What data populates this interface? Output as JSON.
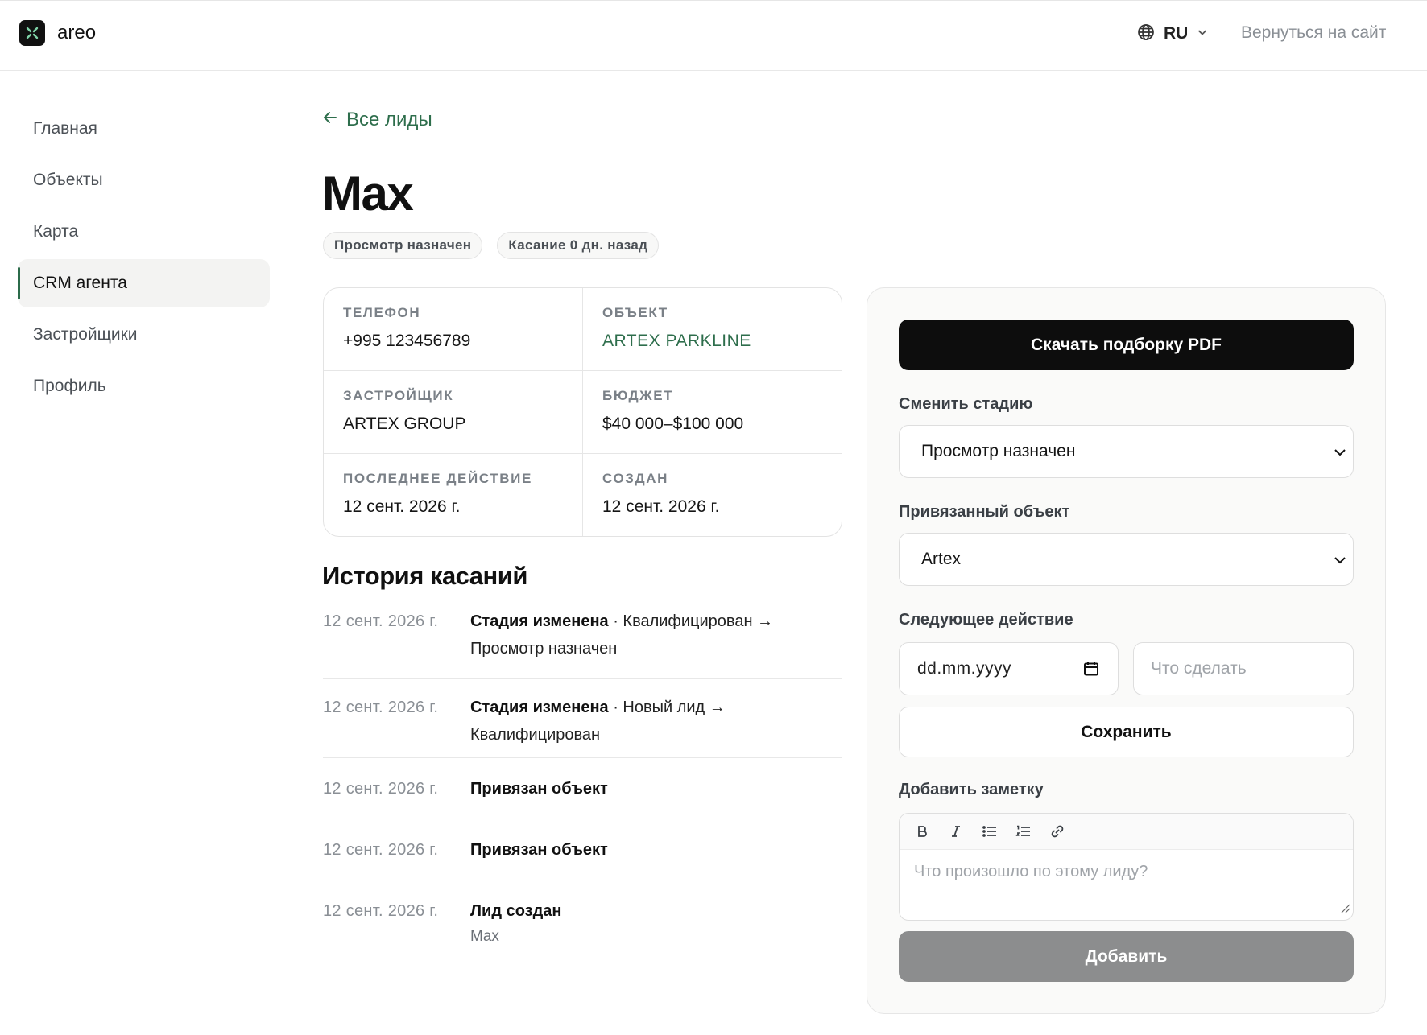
{
  "brand": {
    "name": "areo"
  },
  "header": {
    "language": "RU",
    "back_to_site": "Вернуться на сайт"
  },
  "sidebar": {
    "items": [
      {
        "label": "Главная",
        "active": false
      },
      {
        "label": "Объекты",
        "active": false
      },
      {
        "label": "Карта",
        "active": false
      },
      {
        "label": "CRM агента",
        "active": true
      },
      {
        "label": "Застройщики",
        "active": false
      },
      {
        "label": "Профиль",
        "active": false
      }
    ]
  },
  "main": {
    "back_link": "Все лиды",
    "title": "Max",
    "badges": [
      "Просмотр назначен",
      "Касание 0 дн. назад"
    ],
    "info": {
      "phone_label": "ТЕЛЕФОН",
      "phone_value": "+995 123456789",
      "object_label": "ОБЪЕКТ",
      "object_value": "ARTEX PARKLINE",
      "developer_label": "ЗАСТРОЙЩИК",
      "developer_value": "ARTEX GROUP",
      "budget_label": "БЮДЖЕТ",
      "budget_value": "$40 000–$100 000",
      "last_action_label": "ПОСЛЕДНЕЕ ДЕЙСТВИЕ",
      "last_action_value": "12 сент. 2026 г.",
      "created_label": "СОЗДАН",
      "created_value": "12 сент. 2026 г."
    },
    "history_title": "История касаний",
    "history": [
      {
        "date": "12 сент. 2026 г.",
        "title": "Стадия изменена",
        "detail": " · Квалифицирован → Просмотр назначен",
        "sub": ""
      },
      {
        "date": "12 сент. 2026 г.",
        "title": "Стадия изменена",
        "detail": " · Новый лид → Квалифицирован",
        "sub": ""
      },
      {
        "date": "12 сент. 2026 г.",
        "title": "Привязан объект",
        "detail": "",
        "sub": ""
      },
      {
        "date": "12 сент. 2026 г.",
        "title": "Привязан объект",
        "detail": "",
        "sub": ""
      },
      {
        "date": "12 сент. 2026 г.",
        "title": "Лид создан",
        "detail": "",
        "sub": "Max"
      }
    ]
  },
  "panel": {
    "download_pdf": "Скачать подборку PDF",
    "stage_label": "Сменить стадию",
    "stage_value": "Просмотр назначен",
    "object_label": "Привязанный объект",
    "object_value": "Artex",
    "next_action_label": "Следующее действие",
    "date_placeholder": "dd.mm.yyyy",
    "todo_placeholder": "Что сделать",
    "save": "Сохранить",
    "note_label": "Добавить заметку",
    "note_placeholder": "Что произошло по этому лиду?",
    "add": "Добавить"
  },
  "colors": {
    "accent_green": "#2e6e4c",
    "primary_dark": "#0d0d0d",
    "disabled_gray": "#8c8d8e"
  },
  "icons": [
    "logo-mark-icon",
    "globe-icon",
    "chevron-down-icon",
    "arrow-left-icon",
    "calendar-icon",
    "bold-icon",
    "italic-icon",
    "bullet-list-icon",
    "numbered-list-icon",
    "link-icon"
  ]
}
